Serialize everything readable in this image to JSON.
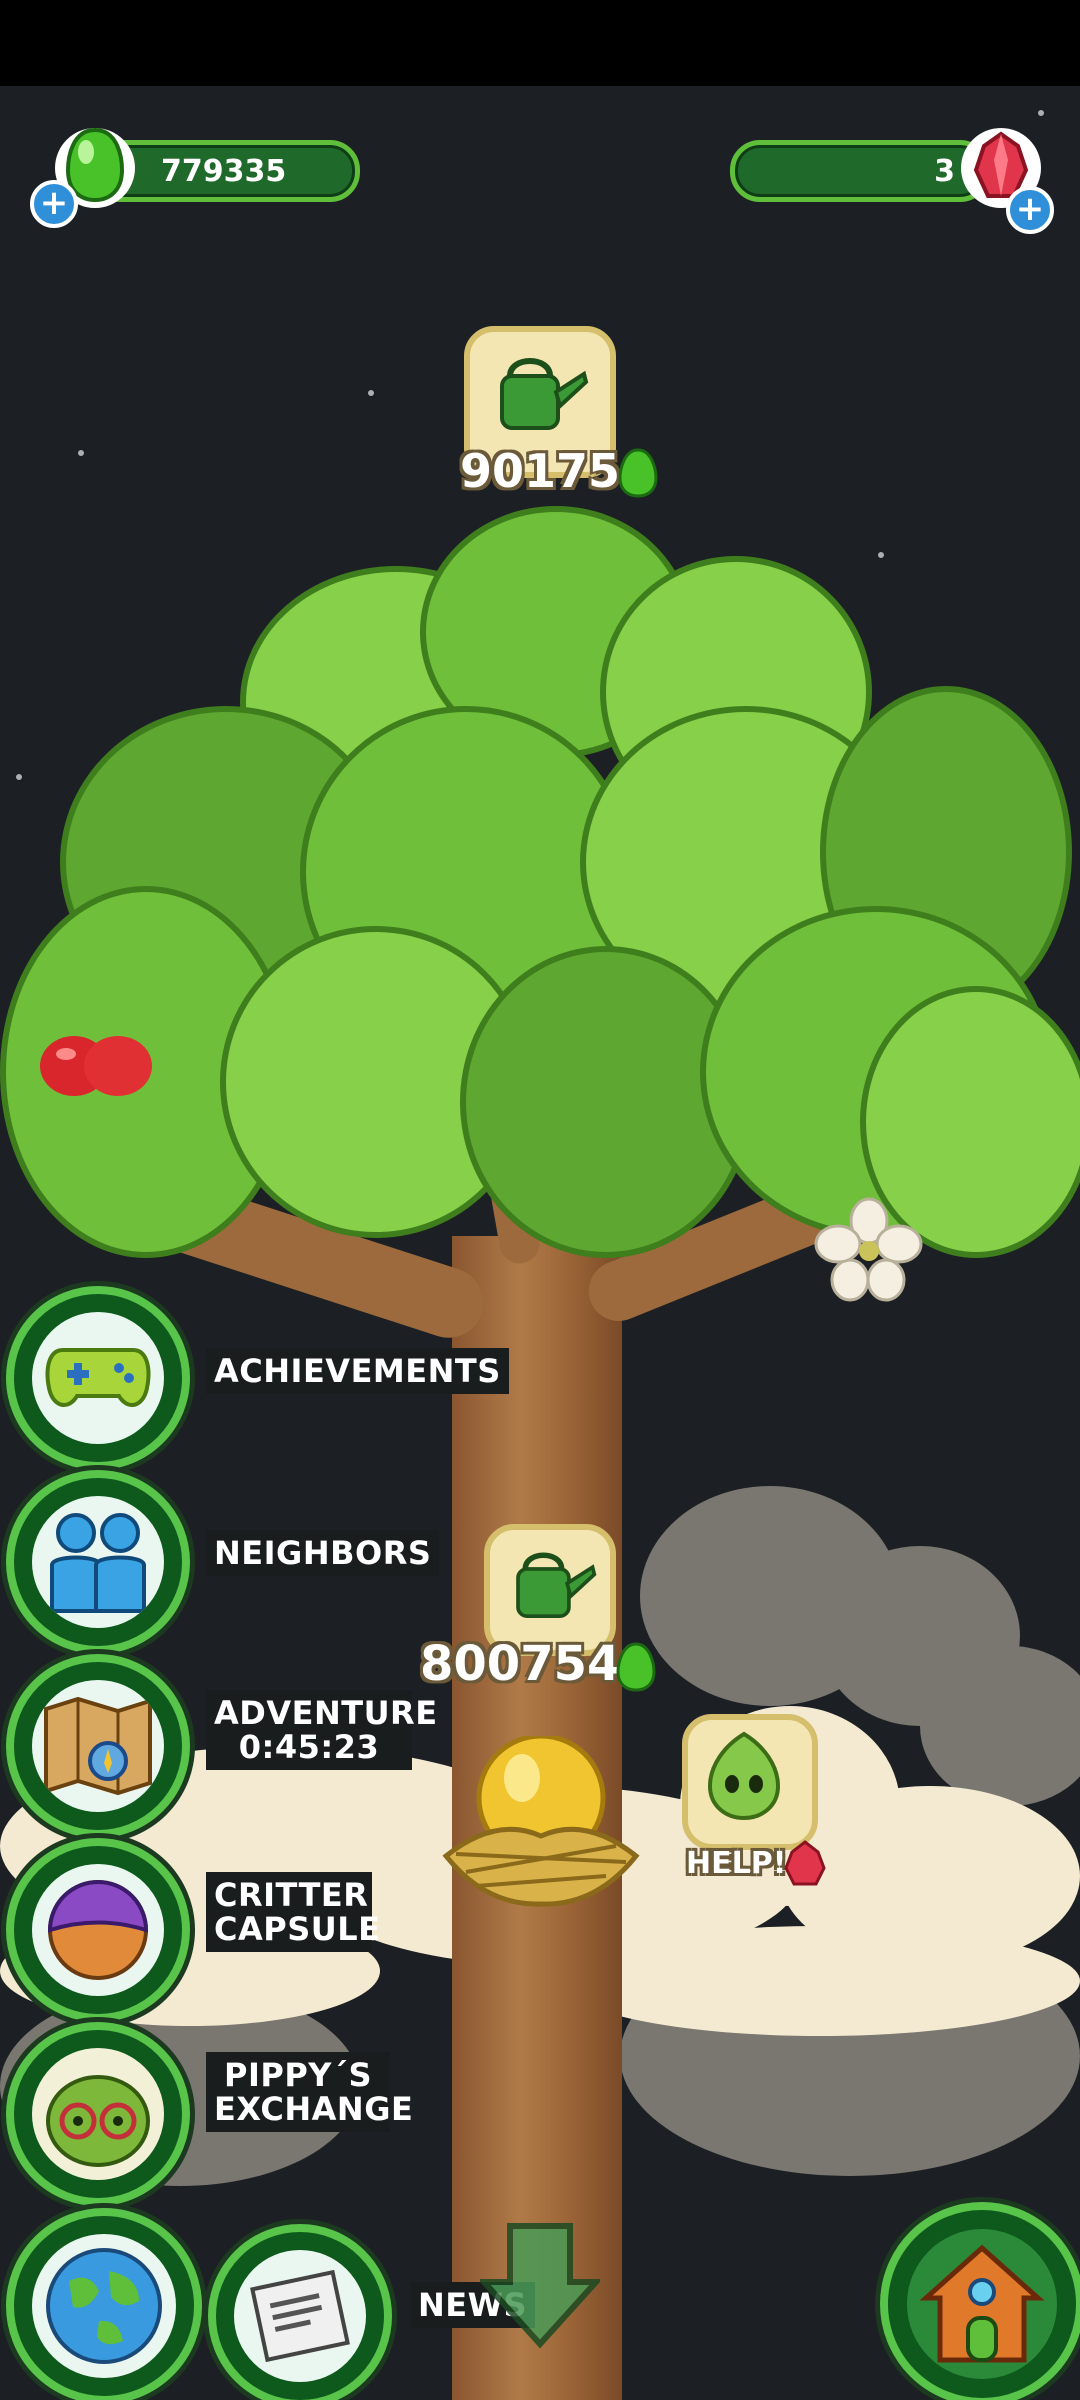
{
  "currencies": {
    "green_drops": {
      "value": "779335",
      "icon": "green-drop-icon",
      "color": "#5fbf3a"
    },
    "red_gems": {
      "value": "3",
      "icon": "red-gem-icon",
      "color": "#d63a4a"
    }
  },
  "watering_top": {
    "value": "90175",
    "icon": "watering-can-icon"
  },
  "watering_trunk": {
    "value": "800754",
    "icon": "watering-can-icon"
  },
  "help_bubble": {
    "label": "HELP!",
    "icon": "leaf-critter-icon"
  },
  "menu": {
    "achievements": "ACHIEVEMENTS",
    "neighbors": "NEIGHBORS",
    "adventure_title": "ADVENTURE",
    "adventure_timer": "0:45:23",
    "critter_capsule_line1": "CRITTER",
    "critter_capsule_line2": "CAPSULE",
    "pippys_exchange_line1": "PIPPY´S",
    "pippys_exchange_line2": "EXCHANGE",
    "news": "NEWS"
  },
  "colors": {
    "sky": "#1c2024",
    "leaf": "#6fbf3a",
    "trunk": "#a06a3a",
    "button_ring": "#58c44a"
  }
}
